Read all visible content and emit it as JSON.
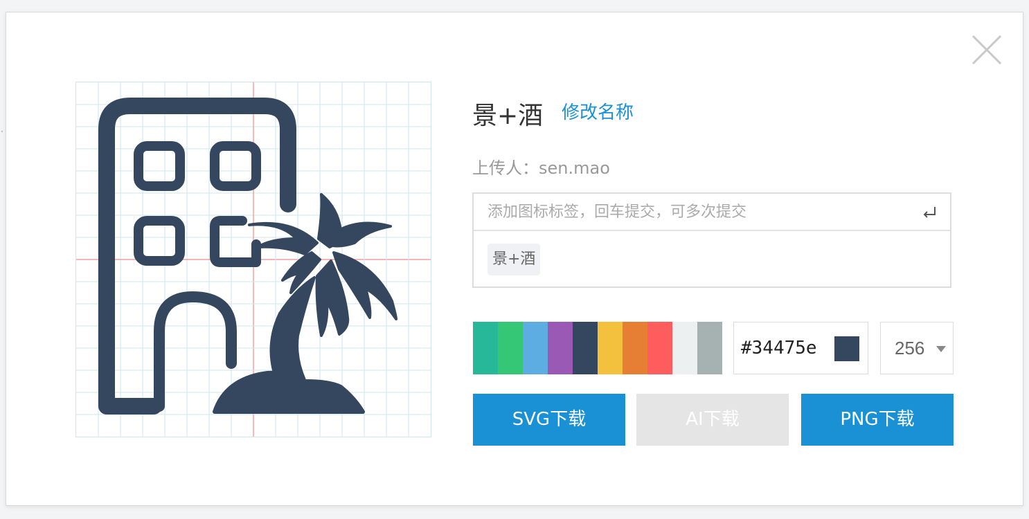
{
  "icon": {
    "name": "景+酒",
    "rename_label": "修改名称",
    "uploader_label": "上传人：",
    "uploader_name": "sen.mao",
    "fill_color": "#34475e"
  },
  "tags": {
    "placeholder": "添加图标标签，回车提交，可多次提交",
    "items": [
      "景+酒"
    ]
  },
  "palette": [
    "#27b899",
    "#35c776",
    "#5dade2",
    "#9b59b6",
    "#34475e",
    "#f3c13d",
    "#e67e33",
    "#fe5d5d",
    "#ecf0f1",
    "#a6b2b1"
  ],
  "color_input": {
    "value": "#34475e"
  },
  "size_select": {
    "value": "256"
  },
  "buttons": {
    "svg_download": "SVG下载",
    "ai_download": "AI下载",
    "png_download": "PNG下载"
  },
  "colors": {
    "accent": "#1a90d5",
    "grid": "#cfe6ec",
    "guide": "#f28a8a",
    "disabled": "#e5e5e5"
  }
}
